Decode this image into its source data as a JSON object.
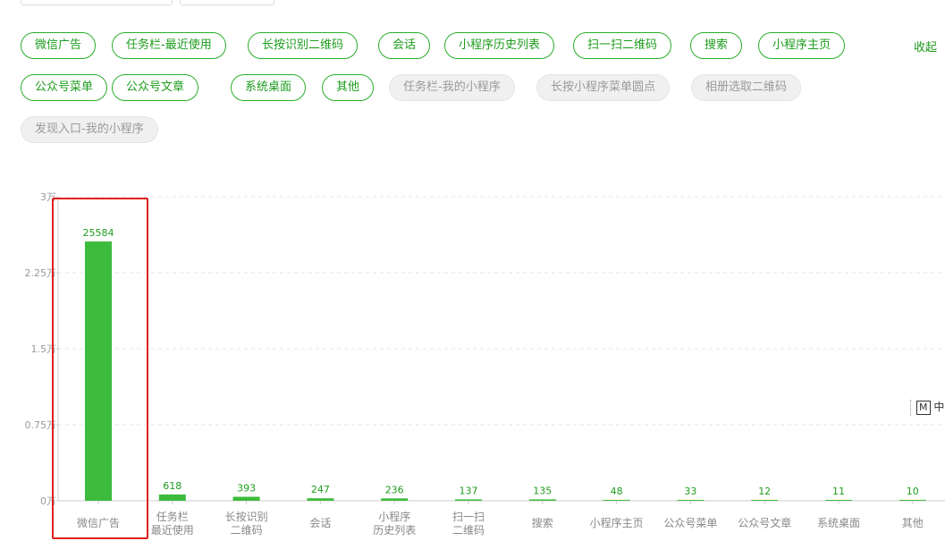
{
  "filters": {
    "active": [
      "微信广告",
      "任务栏-最近使用",
      "长按识别二维码",
      "会话",
      "小程序历史列表",
      "扫一扫二维码",
      "搜索",
      "小程序主页",
      "公众号菜单",
      "公众号文章",
      "系统桌面",
      "其他"
    ],
    "inactive": [
      "任务栏-我的小程序",
      "长按小程序菜单圆点",
      "相册选取二维码",
      "发现入口-我的小程序"
    ],
    "collapse_label": "收起"
  },
  "toolbar": {
    "m_label": "M",
    "char_label": "中"
  },
  "colors": {
    "accent": "#2aae2a",
    "bar": "#3dbb3d",
    "highlight": "#e02020"
  },
  "chart_data": {
    "type": "bar",
    "categories": [
      "微信广告",
      "任务栏\n最近使用",
      "长按识别\n二维码",
      "会话",
      "小程序\n历史列表",
      "扫一扫\n二维码",
      "搜索",
      "小程序主页",
      "公众号菜单",
      "公众号文章",
      "系统桌面",
      "其他"
    ],
    "values": [
      25584,
      618,
      393,
      247,
      236,
      137,
      135,
      48,
      33,
      12,
      11,
      10
    ],
    "yticks": [
      "0万",
      "0.75万",
      "1.5万",
      "2.25万",
      "3万"
    ],
    "ylim": [
      0,
      30000
    ],
    "grid": true,
    "highlighted": "微信广告"
  }
}
